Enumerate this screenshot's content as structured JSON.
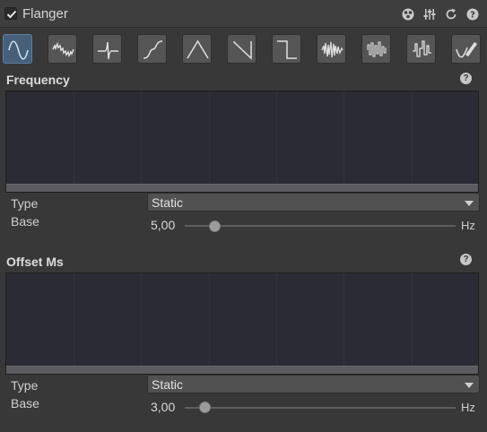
{
  "header": {
    "title": "Flanger",
    "enabled": true
  },
  "header_icons": [
    "preset-icon",
    "mixer-icon",
    "reset-icon",
    "help-icon"
  ],
  "waveforms": [
    "sine",
    "noise-sine",
    "pulse",
    "s-curve",
    "triangle",
    "sawtooth",
    "square",
    "noise",
    "random-steps",
    "random-bars",
    "custom-draw"
  ],
  "selected_waveform": "sine",
  "frequency": {
    "title": "Frequency",
    "type_label": "Type",
    "type_value": "Static",
    "base_label": "Base",
    "base_value": "5,00",
    "unit": "Hz",
    "slider_fraction": 0.11
  },
  "offset": {
    "title": "Offset Ms",
    "type_label": "Type",
    "type_value": "Static",
    "base_label": "Base",
    "base_value": "3,00",
    "unit": "Hz",
    "slider_fraction": 0.075
  },
  "colors": {
    "accent": "#46607a",
    "panel": "#383838",
    "curve_bg": "#2b2b35"
  }
}
